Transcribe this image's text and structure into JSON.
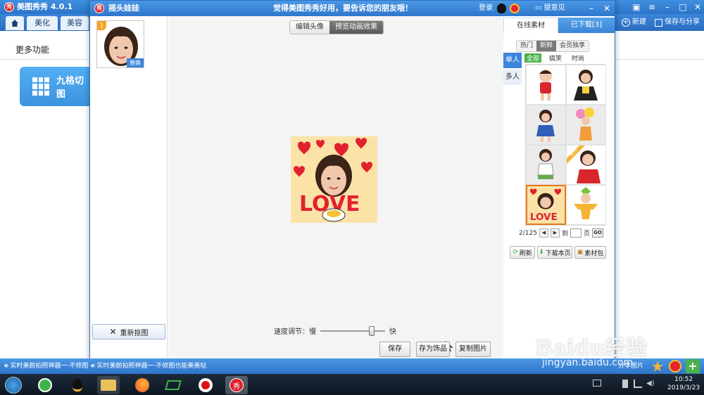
{
  "bg_app": {
    "title": "美图秀秀 4.0.1",
    "tabs": [
      "美化",
      "美容"
    ],
    "section_title": "更多功能",
    "feature_button": "九格切图",
    "new_label": "新建",
    "save_share_label": "保存与分享"
  },
  "dialog": {
    "title": "摇头娃娃",
    "slogan": "觉得美图秀秀好用，要告诉您的朋友哦！",
    "login": "登录",
    "feedback": "提意见",
    "thumb_badge": "1",
    "thumb_replace": "替换",
    "recrop_label": "重新抠图",
    "mode_tabs": {
      "edit": "编辑头像",
      "preview": "预览动画效果"
    },
    "speed_label": "速度调节：慢",
    "speed_fast": "快",
    "speed_level_percent": 82,
    "save_label": "保存",
    "save_as_label": "存为饰品",
    "copy_label": "复制图片",
    "preview_text": "LOVE"
  },
  "materials": {
    "tab_online": "在线素材",
    "tab_downloaded": "已下载[3]",
    "filters": [
      "热门",
      "新鲜",
      "会员独享"
    ],
    "active_filter": "新鲜",
    "vertical_tabs": [
      "单人",
      "多人"
    ],
    "sub_filters": [
      "全部",
      "搞笑",
      "时尚"
    ],
    "vip_ribbon": "会员",
    "pager": {
      "current": "2/125",
      "to": "到",
      "page": "页",
      "go": "GO"
    },
    "actions": [
      "刷新",
      "下载本页",
      "素材包"
    ]
  },
  "status": {
    "left_text": "实时美颜拍照神器一·不修图",
    "center_text": "实时美颜拍照神器一·不修图也能美美哒",
    "share_label": "分享图片"
  },
  "taskbar": {
    "time": "10:52",
    "date": "2019/3/23"
  },
  "watermark": {
    "brand": "Baidu经验",
    "url": "jingyan.baidu.com"
  },
  "colors": {
    "accent": "#2f77cc",
    "selected_border": "#e77a1c",
    "green_tag": "#4bb14b"
  }
}
